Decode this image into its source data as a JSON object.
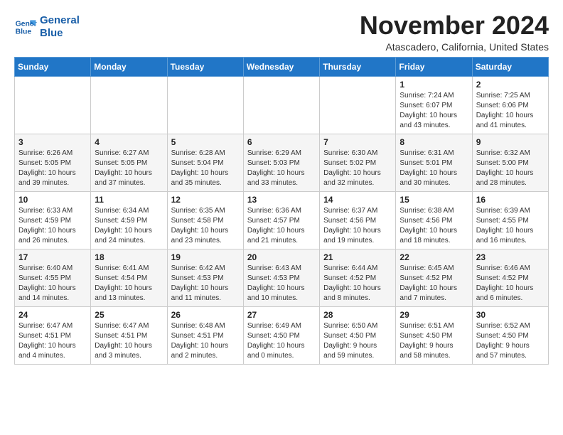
{
  "logo": {
    "line1": "General",
    "line2": "Blue"
  },
  "title": "November 2024",
  "subtitle": "Atascadero, California, United States",
  "days_of_week": [
    "Sunday",
    "Monday",
    "Tuesday",
    "Wednesday",
    "Thursday",
    "Friday",
    "Saturday"
  ],
  "weeks": [
    [
      {
        "day": "",
        "info": ""
      },
      {
        "day": "",
        "info": ""
      },
      {
        "day": "",
        "info": ""
      },
      {
        "day": "",
        "info": ""
      },
      {
        "day": "",
        "info": ""
      },
      {
        "day": "1",
        "info": "Sunrise: 7:24 AM\nSunset: 6:07 PM\nDaylight: 10 hours\nand 43 minutes."
      },
      {
        "day": "2",
        "info": "Sunrise: 7:25 AM\nSunset: 6:06 PM\nDaylight: 10 hours\nand 41 minutes."
      }
    ],
    [
      {
        "day": "3",
        "info": "Sunrise: 6:26 AM\nSunset: 5:05 PM\nDaylight: 10 hours\nand 39 minutes."
      },
      {
        "day": "4",
        "info": "Sunrise: 6:27 AM\nSunset: 5:05 PM\nDaylight: 10 hours\nand 37 minutes."
      },
      {
        "day": "5",
        "info": "Sunrise: 6:28 AM\nSunset: 5:04 PM\nDaylight: 10 hours\nand 35 minutes."
      },
      {
        "day": "6",
        "info": "Sunrise: 6:29 AM\nSunset: 5:03 PM\nDaylight: 10 hours\nand 33 minutes."
      },
      {
        "day": "7",
        "info": "Sunrise: 6:30 AM\nSunset: 5:02 PM\nDaylight: 10 hours\nand 32 minutes."
      },
      {
        "day": "8",
        "info": "Sunrise: 6:31 AM\nSunset: 5:01 PM\nDaylight: 10 hours\nand 30 minutes."
      },
      {
        "day": "9",
        "info": "Sunrise: 6:32 AM\nSunset: 5:00 PM\nDaylight: 10 hours\nand 28 minutes."
      }
    ],
    [
      {
        "day": "10",
        "info": "Sunrise: 6:33 AM\nSunset: 4:59 PM\nDaylight: 10 hours\nand 26 minutes."
      },
      {
        "day": "11",
        "info": "Sunrise: 6:34 AM\nSunset: 4:59 PM\nDaylight: 10 hours\nand 24 minutes."
      },
      {
        "day": "12",
        "info": "Sunrise: 6:35 AM\nSunset: 4:58 PM\nDaylight: 10 hours\nand 23 minutes."
      },
      {
        "day": "13",
        "info": "Sunrise: 6:36 AM\nSunset: 4:57 PM\nDaylight: 10 hours\nand 21 minutes."
      },
      {
        "day": "14",
        "info": "Sunrise: 6:37 AM\nSunset: 4:56 PM\nDaylight: 10 hours\nand 19 minutes."
      },
      {
        "day": "15",
        "info": "Sunrise: 6:38 AM\nSunset: 4:56 PM\nDaylight: 10 hours\nand 18 minutes."
      },
      {
        "day": "16",
        "info": "Sunrise: 6:39 AM\nSunset: 4:55 PM\nDaylight: 10 hours\nand 16 minutes."
      }
    ],
    [
      {
        "day": "17",
        "info": "Sunrise: 6:40 AM\nSunset: 4:55 PM\nDaylight: 10 hours\nand 14 minutes."
      },
      {
        "day": "18",
        "info": "Sunrise: 6:41 AM\nSunset: 4:54 PM\nDaylight: 10 hours\nand 13 minutes."
      },
      {
        "day": "19",
        "info": "Sunrise: 6:42 AM\nSunset: 4:53 PM\nDaylight: 10 hours\nand 11 minutes."
      },
      {
        "day": "20",
        "info": "Sunrise: 6:43 AM\nSunset: 4:53 PM\nDaylight: 10 hours\nand 10 minutes."
      },
      {
        "day": "21",
        "info": "Sunrise: 6:44 AM\nSunset: 4:52 PM\nDaylight: 10 hours\nand 8 minutes."
      },
      {
        "day": "22",
        "info": "Sunrise: 6:45 AM\nSunset: 4:52 PM\nDaylight: 10 hours\nand 7 minutes."
      },
      {
        "day": "23",
        "info": "Sunrise: 6:46 AM\nSunset: 4:52 PM\nDaylight: 10 hours\nand 6 minutes."
      }
    ],
    [
      {
        "day": "24",
        "info": "Sunrise: 6:47 AM\nSunset: 4:51 PM\nDaylight: 10 hours\nand 4 minutes."
      },
      {
        "day": "25",
        "info": "Sunrise: 6:47 AM\nSunset: 4:51 PM\nDaylight: 10 hours\nand 3 minutes."
      },
      {
        "day": "26",
        "info": "Sunrise: 6:48 AM\nSunset: 4:51 PM\nDaylight: 10 hours\nand 2 minutes."
      },
      {
        "day": "27",
        "info": "Sunrise: 6:49 AM\nSunset: 4:50 PM\nDaylight: 10 hours\nand 0 minutes."
      },
      {
        "day": "28",
        "info": "Sunrise: 6:50 AM\nSunset: 4:50 PM\nDaylight: 9 hours\nand 59 minutes."
      },
      {
        "day": "29",
        "info": "Sunrise: 6:51 AM\nSunset: 4:50 PM\nDaylight: 9 hours\nand 58 minutes."
      },
      {
        "day": "30",
        "info": "Sunrise: 6:52 AM\nSunset: 4:50 PM\nDaylight: 9 hours\nand 57 minutes."
      }
    ]
  ]
}
